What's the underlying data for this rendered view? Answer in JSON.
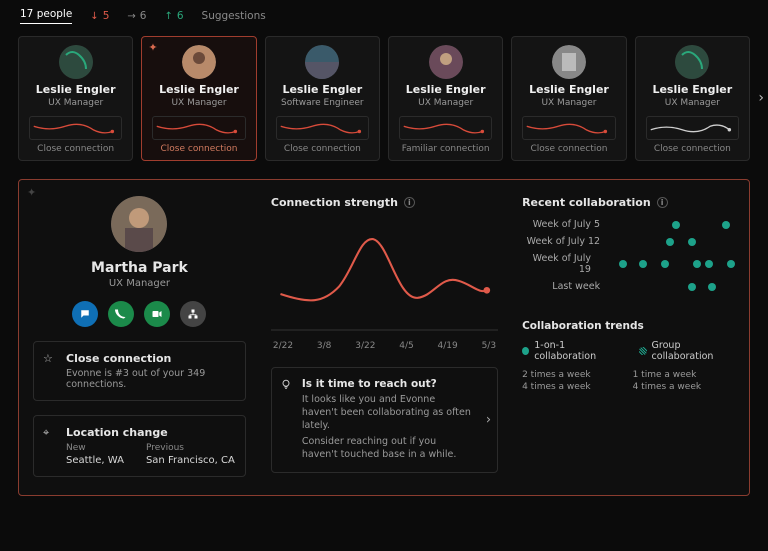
{
  "tabs": {
    "people": "17 people",
    "down": "5",
    "right": "6",
    "up": "6",
    "suggestions": "Suggestions"
  },
  "cards": [
    {
      "name": "Leslie Engler",
      "role": "UX Manager",
      "conn": "Close connection",
      "spark_color": "#d84b3a"
    },
    {
      "name": "Leslie Engler",
      "role": "UX Manager",
      "conn": "Close connection",
      "spark_color": "#d84b3a",
      "selected": true
    },
    {
      "name": "Leslie Engler",
      "role": "Software Engineer",
      "conn": "Close connection",
      "spark_color": "#d84b3a"
    },
    {
      "name": "Leslie Engler",
      "role": "UX Manager",
      "conn": "Familiar connection",
      "spark_color": "#d84b3a"
    },
    {
      "name": "Leslie Engler",
      "role": "UX Manager",
      "conn": "Close connection",
      "spark_color": "#d84b3a"
    },
    {
      "name": "Leslie Engler",
      "role": "UX Manager",
      "conn": "Close connection",
      "spark_color": "#d0d0d0"
    }
  ],
  "profile": {
    "name": "Martha Park",
    "role": "UX Manager"
  },
  "close": {
    "title": "Close connection",
    "sub": "Evonne is #3 out of your 349 connections."
  },
  "location": {
    "title": "Location change",
    "new_h": "New",
    "new_v": "Seattle, WA",
    "prev_h": "Previous",
    "prev_v": "San Francisco, CA"
  },
  "strength": {
    "title": "Connection strength"
  },
  "chart_data": {
    "type": "line",
    "x": [
      "2/22",
      "3/8",
      "3/22",
      "4/5",
      "4/19",
      "5/3"
    ],
    "values": [
      35,
      30,
      88,
      34,
      50,
      42
    ],
    "ylim": [
      0,
      100
    ],
    "color": "#e05a4a"
  },
  "tip": {
    "title": "Is it time to reach out?",
    "p1": "It looks like you and Evonne haven't been collaborating as often lately.",
    "p2": "Consider reaching out if you haven't touched base in a while."
  },
  "recent": {
    "title": "Recent collaboration",
    "rows": [
      "Week of July 5",
      "Week of July 12",
      "Week of July 19",
      "Last week"
    ]
  },
  "trends": {
    "title": "Collaboration trends",
    "legend": {
      "one": "1-on-1 collaboration",
      "group": "Group collaboration"
    },
    "one_vals": [
      "2 times a week",
      "4 times a week"
    ],
    "group_vals": [
      "1 time a week",
      "4 times a week"
    ]
  }
}
